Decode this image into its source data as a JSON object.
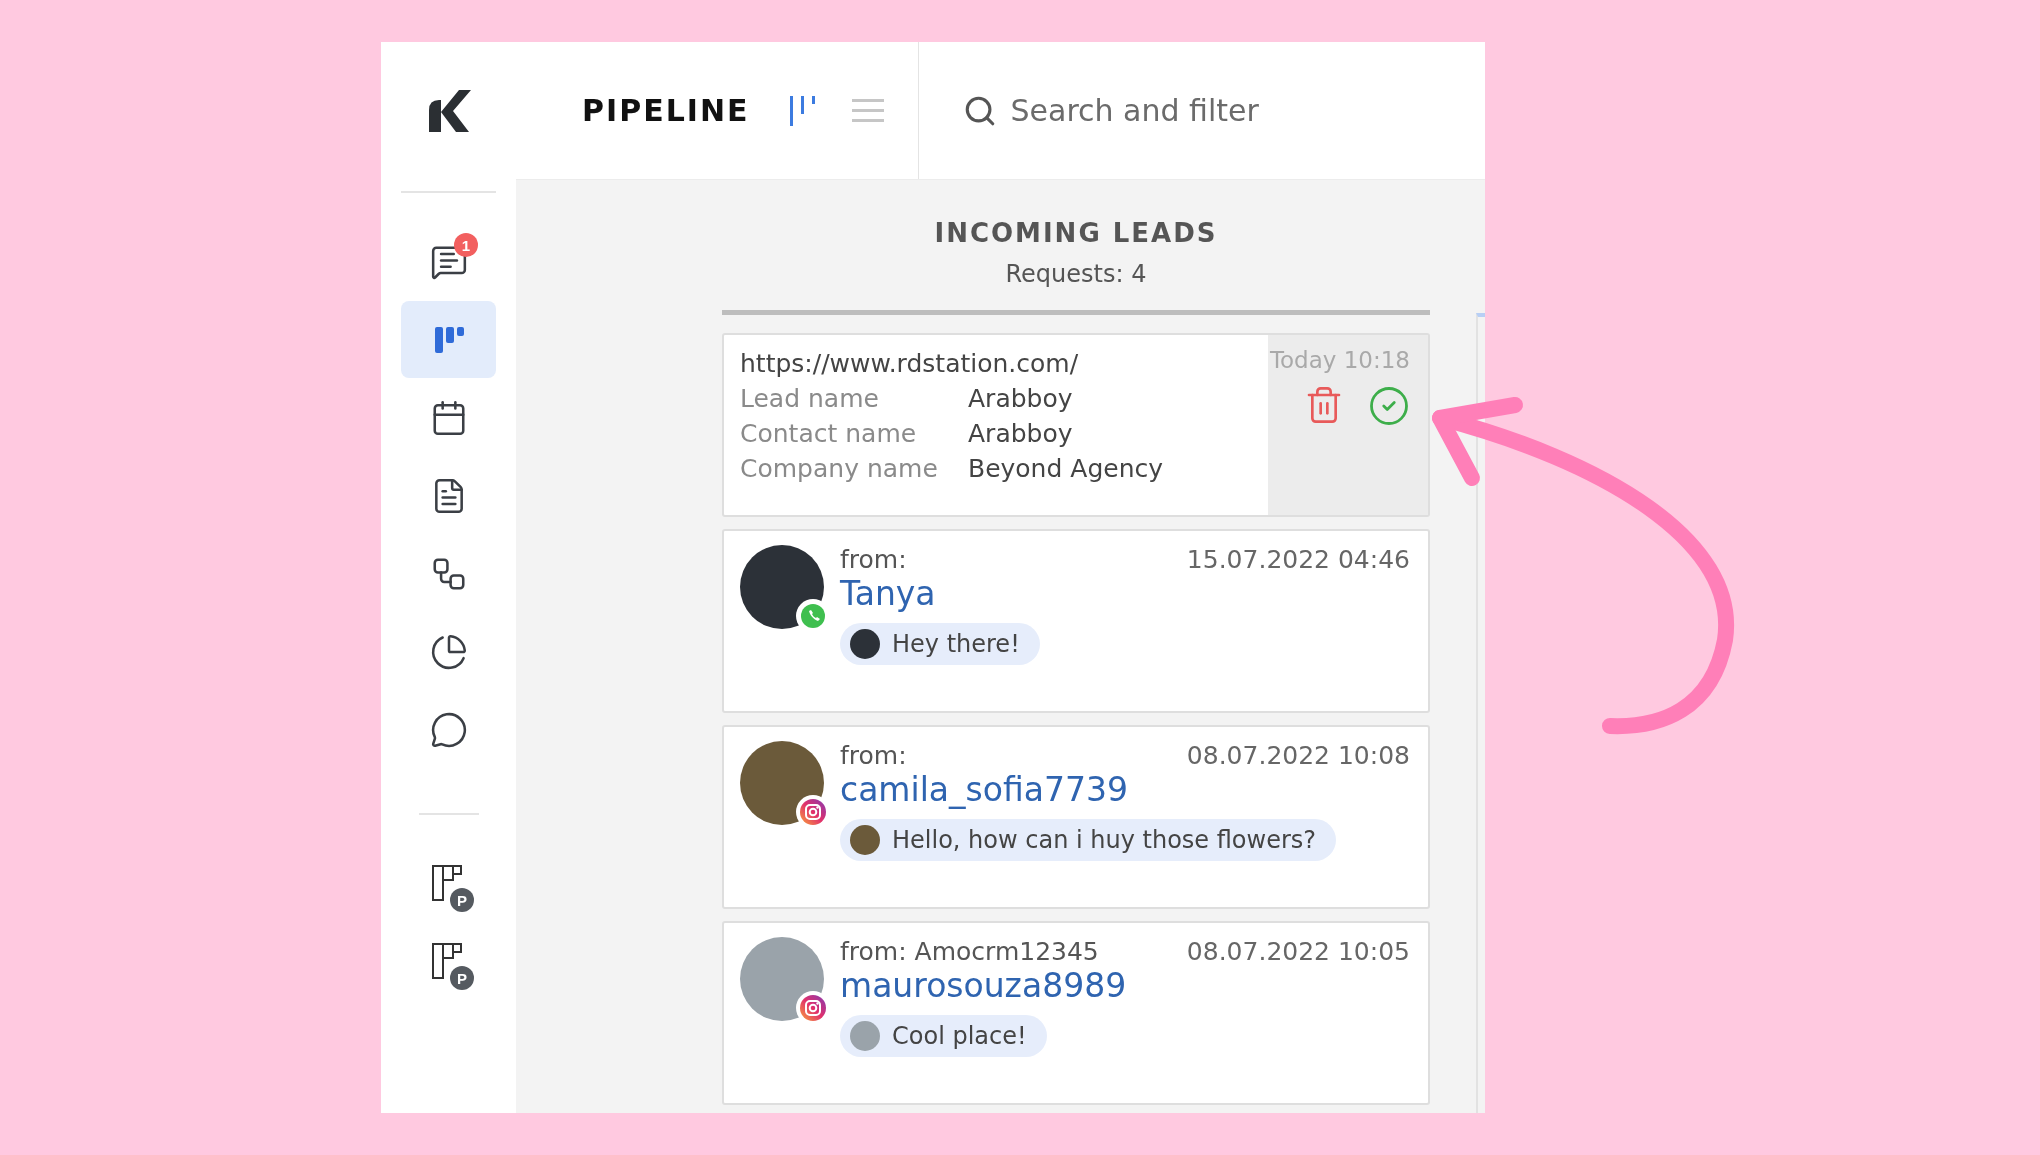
{
  "header": {
    "title": "PIPELINE",
    "views": [
      {
        "kind": "kanban",
        "selected": true
      },
      {
        "kind": "list",
        "selected": false
      }
    ],
    "search": {
      "placeholder": "Search and filter"
    }
  },
  "sidebar": {
    "items": [
      {
        "kind": "chat",
        "badge": "1",
        "selected": false
      },
      {
        "kind": "pipeline",
        "selected": true
      },
      {
        "kind": "calendar",
        "selected": false
      },
      {
        "kind": "document",
        "selected": false
      },
      {
        "kind": "branch",
        "selected": false
      },
      {
        "kind": "chart",
        "selected": false
      },
      {
        "kind": "whatsapp",
        "selected": false
      }
    ],
    "extra_items": [
      {
        "kind": "board",
        "badge": "P",
        "selected": false
      },
      {
        "kind": "board",
        "badge": "P",
        "selected": false
      }
    ]
  },
  "column": {
    "title": "INCOMING LEADS",
    "count": "Requests: 4",
    "cards": [
      {
        "kind": "form",
        "source": "https://www.rdstation.com/",
        "date": "Today 10:18",
        "fields": [
          {
            "label": "Lead name",
            "value": "Arabboy"
          },
          {
            "label": "Contact name",
            "value": "Arabboy"
          },
          {
            "label": "Company name",
            "value": "Beyond Agency"
          }
        ]
      },
      {
        "kind": "chat",
        "channel": {
          "kind": "whatsapp"
        },
        "from": "from:",
        "date": "15.07.2022 04:46",
        "name": "Tanya",
        "message": "Hey there!"
      },
      {
        "kind": "chat",
        "channel": {
          "kind": "instagram"
        },
        "from": "from:",
        "date": "08.07.2022 10:08",
        "name": "camila_sofia7739",
        "message": "Hello, how can i huy those flowers?"
      },
      {
        "kind": "chat",
        "channel": {
          "kind": "instagram"
        },
        "from": "from: Amocrm12345",
        "date": "08.07.2022 10:05",
        "name": "maurosouza8989",
        "message": "Cool place!"
      }
    ]
  }
}
